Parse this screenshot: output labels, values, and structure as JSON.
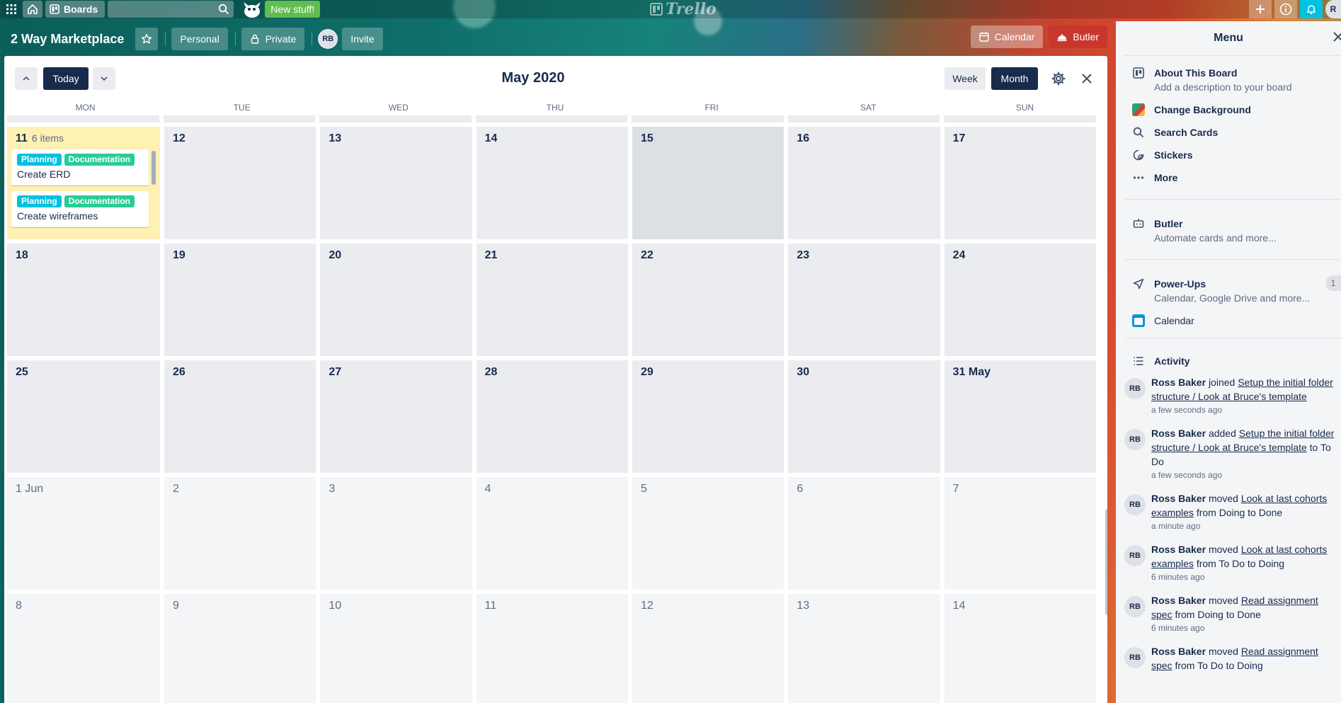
{
  "topbar": {
    "boards_label": "Boards",
    "new_stuff": "New stuff!",
    "logo_text": "Trello",
    "avatar_initial": "R"
  },
  "board": {
    "title": "2 Way Marketplace",
    "team_label": "Personal",
    "visibility_label": "Private",
    "member_initials": "RB",
    "invite_label": "Invite",
    "calendar_label": "Calendar",
    "butler_label": "Butler"
  },
  "calendar": {
    "title": "May 2020",
    "today_label": "Today",
    "week_label": "Week",
    "month_label": "Month",
    "weekdays": [
      "MON",
      "TUE",
      "WED",
      "THU",
      "FRI",
      "SAT",
      "SUN"
    ],
    "days": [
      "11",
      "12",
      "13",
      "14",
      "15",
      "16",
      "17",
      "18",
      "19",
      "20",
      "21",
      "22",
      "23",
      "24",
      "25",
      "26",
      "27",
      "28",
      "29",
      "30",
      "31 May",
      "1 Jun",
      "2",
      "3",
      "4",
      "5",
      "6",
      "7",
      "8",
      "9",
      "10",
      "11",
      "12",
      "13",
      "14"
    ],
    "today_count": "6 items",
    "cards": [
      {
        "labels": [
          "Planning",
          "Documentation"
        ],
        "title": "Create ERD"
      },
      {
        "labels": [
          "Planning",
          "Documentation"
        ],
        "title": "Create wireframes"
      }
    ]
  },
  "menu": {
    "title": "Menu",
    "about_title": "About This Board",
    "about_sub": "Add a description to your board",
    "change_bg": "Change Background",
    "search_cards": "Search Cards",
    "stickers": "Stickers",
    "more": "More",
    "butler_title": "Butler",
    "butler_sub": "Automate cards and more...",
    "powerups_title": "Power-Ups",
    "powerups_sub": "Calendar, Google Drive and more...",
    "powerups_count": "1",
    "calendar_item": "Calendar",
    "activity_title": "Activity",
    "activity": [
      {
        "initials": "RB",
        "user": "Ross Baker",
        "action": "joined",
        "link": "Setup the initial folder structure / Look at Bruce's template",
        "rest": "",
        "time": "a few seconds ago"
      },
      {
        "initials": "RB",
        "user": "Ross Baker",
        "action": "added",
        "link": "Setup the initial folder structure / Look at Bruce's template",
        "rest": "to To Do",
        "time": "a few seconds ago"
      },
      {
        "initials": "RB",
        "user": "Ross Baker",
        "action": "moved",
        "link": "Look at last cohorts examples",
        "rest": "from Doing to Done",
        "time": "a minute ago"
      },
      {
        "initials": "RB",
        "user": "Ross Baker",
        "action": "moved",
        "link": "Look at last cohorts examples",
        "rest": "from To Do to Doing",
        "time": "6 minutes ago"
      },
      {
        "initials": "RB",
        "user": "Ross Baker",
        "action": "moved",
        "link": "Read assignment spec",
        "rest": "from Doing to Done",
        "time": "6 minutes ago"
      },
      {
        "initials": "RB",
        "user": "Ross Baker",
        "action": "moved",
        "link": "Read assignment spec",
        "rest": "from To Do to Doing",
        "time": ""
      }
    ]
  }
}
